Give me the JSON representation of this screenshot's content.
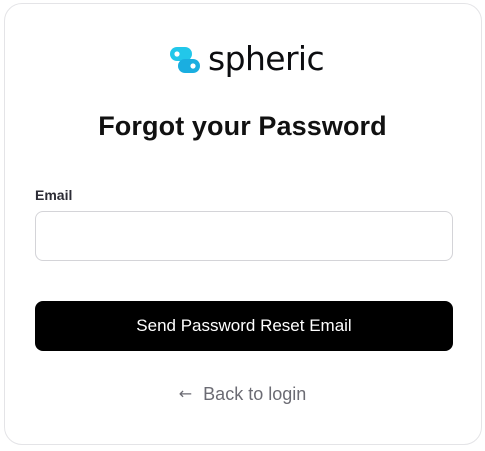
{
  "brand": {
    "name": "spheric",
    "logo_icon": "spheric-logo-mark-icon",
    "accent_color": "#22c7ea"
  },
  "page": {
    "title": "Forgot your Password"
  },
  "form": {
    "email_label": "Email",
    "email_value": "",
    "email_placeholder": "",
    "submit_label": "Send Password Reset Email"
  },
  "footer": {
    "back_icon": "arrow-left-icon",
    "back_glyph": "←",
    "back_label": "Back to login"
  }
}
